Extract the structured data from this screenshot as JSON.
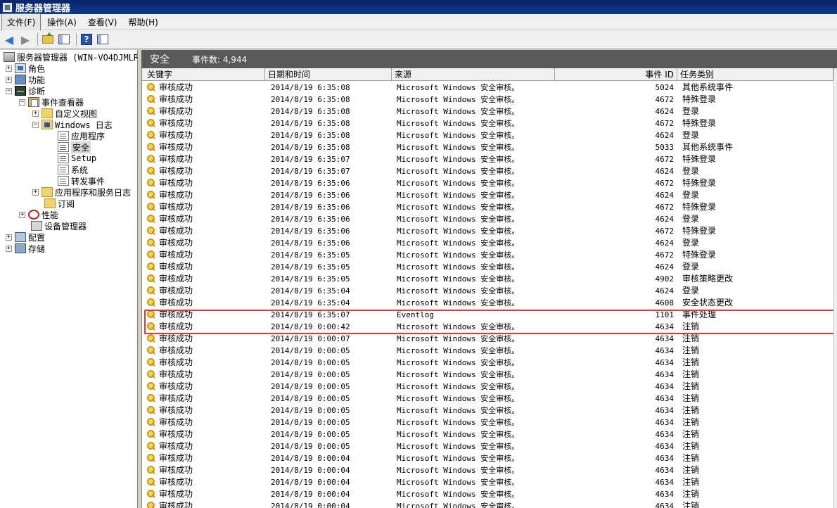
{
  "window": {
    "title": "服务器管理器"
  },
  "menu": [
    "文件(F)",
    "操作(A)",
    "查看(V)",
    "帮助(H)"
  ],
  "toolbar": {
    "icons": [
      "back-arrow-icon",
      "forward-arrow-icon",
      "up-folder-icon",
      "show-hide-tree-icon",
      "help-icon",
      "properties-panel-icon"
    ],
    "help_glyph": "?"
  },
  "tree": {
    "root": "服务器管理器 (WIN-VO4DJMLR70",
    "roles": "角色",
    "features": "功能",
    "diagnostics": "诊断",
    "event_viewer": "事件查看器",
    "custom_views": "自定义视图",
    "windows_logs": "Windows 日志",
    "application": "应用程序",
    "security": "安全",
    "setup": "Setup",
    "system": "系统",
    "forwarded": "转发事件",
    "app_service_logs": "应用程序和服务日志",
    "subscriptions": "订阅",
    "performance": "性能",
    "device_manager": "设备管理器",
    "configuration": "配置",
    "storage": "存储",
    "plus": "+",
    "minus": "−"
  },
  "content": {
    "title": "安全",
    "event_count": "事件数: 4,944"
  },
  "columns": {
    "keyword": "关键字",
    "datetime": "日期和时间",
    "source": "来源",
    "event_id": "事件 ID",
    "category": "任务类别"
  },
  "rows": [
    {
      "k": "审核成功",
      "d": "2014/8/19 6:35:08",
      "s": "Microsoft Windows 安全审核。",
      "id": "5024",
      "c": "其他系统事件"
    },
    {
      "k": "审核成功",
      "d": "2014/8/19 6:35:08",
      "s": "Microsoft Windows 安全审核。",
      "id": "4672",
      "c": "特殊登录"
    },
    {
      "k": "审核成功",
      "d": "2014/8/19 6:35:08",
      "s": "Microsoft Windows 安全审核。",
      "id": "4624",
      "c": "登录"
    },
    {
      "k": "审核成功",
      "d": "2014/8/19 6:35:08",
      "s": "Microsoft Windows 安全审核。",
      "id": "4672",
      "c": "特殊登录"
    },
    {
      "k": "审核成功",
      "d": "2014/8/19 6:35:08",
      "s": "Microsoft Windows 安全审核。",
      "id": "4624",
      "c": "登录"
    },
    {
      "k": "审核成功",
      "d": "2014/8/19 6:35:08",
      "s": "Microsoft Windows 安全审核。",
      "id": "5033",
      "c": "其他系统事件"
    },
    {
      "k": "审核成功",
      "d": "2014/8/19 6:35:07",
      "s": "Microsoft Windows 安全审核。",
      "id": "4672",
      "c": "特殊登录"
    },
    {
      "k": "审核成功",
      "d": "2014/8/19 6:35:07",
      "s": "Microsoft Windows 安全审核。",
      "id": "4624",
      "c": "登录"
    },
    {
      "k": "审核成功",
      "d": "2014/8/19 6:35:06",
      "s": "Microsoft Windows 安全审核。",
      "id": "4672",
      "c": "特殊登录"
    },
    {
      "k": "审核成功",
      "d": "2014/8/19 6:35:06",
      "s": "Microsoft Windows 安全审核。",
      "id": "4624",
      "c": "登录"
    },
    {
      "k": "审核成功",
      "d": "2014/8/19 6:35:06",
      "s": "Microsoft Windows 安全审核。",
      "id": "4672",
      "c": "特殊登录"
    },
    {
      "k": "审核成功",
      "d": "2014/8/19 6:35:06",
      "s": "Microsoft Windows 安全审核。",
      "id": "4624",
      "c": "登录"
    },
    {
      "k": "审核成功",
      "d": "2014/8/19 6:35:06",
      "s": "Microsoft Windows 安全审核。",
      "id": "4672",
      "c": "特殊登录"
    },
    {
      "k": "审核成功",
      "d": "2014/8/19 6:35:06",
      "s": "Microsoft Windows 安全审核。",
      "id": "4624",
      "c": "登录"
    },
    {
      "k": "审核成功",
      "d": "2014/8/19 6:35:05",
      "s": "Microsoft Windows 安全审核。",
      "id": "4672",
      "c": "特殊登录"
    },
    {
      "k": "审核成功",
      "d": "2014/8/19 6:35:05",
      "s": "Microsoft Windows 安全审核。",
      "id": "4624",
      "c": "登录"
    },
    {
      "k": "审核成功",
      "d": "2014/8/19 6:35:05",
      "s": "Microsoft Windows 安全审核。",
      "id": "4902",
      "c": "审核策略更改"
    },
    {
      "k": "审核成功",
      "d": "2014/8/19 6:35:04",
      "s": "Microsoft Windows 安全审核。",
      "id": "4624",
      "c": "登录"
    },
    {
      "k": "审核成功",
      "d": "2014/8/19 6:35:04",
      "s": "Microsoft Windows 安全审核。",
      "id": "4608",
      "c": "安全状态更改"
    },
    {
      "k": "审核成功",
      "d": "2014/8/19 6:35:07",
      "s": "Eventlog",
      "id": "1101",
      "c": "事件处理"
    },
    {
      "k": "审核成功",
      "d": "2014/8/19 0:00:42",
      "s": "Microsoft Windows 安全审核。",
      "id": "4634",
      "c": "注销"
    },
    {
      "k": "审核成功",
      "d": "2014/8/19 0:00:07",
      "s": "Microsoft Windows 安全审核。",
      "id": "4634",
      "c": "注销"
    },
    {
      "k": "审核成功",
      "d": "2014/8/19 0:00:05",
      "s": "Microsoft Windows 安全审核。",
      "id": "4634",
      "c": "注销"
    },
    {
      "k": "审核成功",
      "d": "2014/8/19 0:00:05",
      "s": "Microsoft Windows 安全审核。",
      "id": "4634",
      "c": "注销"
    },
    {
      "k": "审核成功",
      "d": "2014/8/19 0:00:05",
      "s": "Microsoft Windows 安全审核。",
      "id": "4634",
      "c": "注销"
    },
    {
      "k": "审核成功",
      "d": "2014/8/19 0:00:05",
      "s": "Microsoft Windows 安全审核。",
      "id": "4634",
      "c": "注销"
    },
    {
      "k": "审核成功",
      "d": "2014/8/19 0:00:05",
      "s": "Microsoft Windows 安全审核。",
      "id": "4634",
      "c": "注销"
    },
    {
      "k": "审核成功",
      "d": "2014/8/19 0:00:05",
      "s": "Microsoft Windows 安全审核。",
      "id": "4634",
      "c": "注销"
    },
    {
      "k": "审核成功",
      "d": "2014/8/19 0:00:05",
      "s": "Microsoft Windows 安全审核。",
      "id": "4634",
      "c": "注销"
    },
    {
      "k": "审核成功",
      "d": "2014/8/19 0:00:05",
      "s": "Microsoft Windows 安全审核。",
      "id": "4634",
      "c": "注销"
    },
    {
      "k": "审核成功",
      "d": "2014/8/19 0:00:05",
      "s": "Microsoft Windows 安全审核。",
      "id": "4634",
      "c": "注销"
    },
    {
      "k": "审核成功",
      "d": "2014/8/19 0:00:04",
      "s": "Microsoft Windows 安全审核。",
      "id": "4634",
      "c": "注销"
    },
    {
      "k": "审核成功",
      "d": "2014/8/19 0:00:04",
      "s": "Microsoft Windows 安全审核。",
      "id": "4634",
      "c": "注销"
    },
    {
      "k": "审核成功",
      "d": "2014/8/19 0:00:04",
      "s": "Microsoft Windows 安全审核。",
      "id": "4634",
      "c": "注销"
    },
    {
      "k": "审核成功",
      "d": "2014/8/19 0:00:04",
      "s": "Microsoft Windows 安全审核。",
      "id": "4634",
      "c": "注销"
    },
    {
      "k": "审核成功",
      "d": "2014/8/19 0:00:04",
      "s": "Microsoft Windows 安全审核。",
      "id": "4634",
      "c": "注销"
    }
  ],
  "colors": {
    "highlight": "#e03a3a",
    "header_bg": "#595959",
    "title_bg": "#0a246a"
  }
}
